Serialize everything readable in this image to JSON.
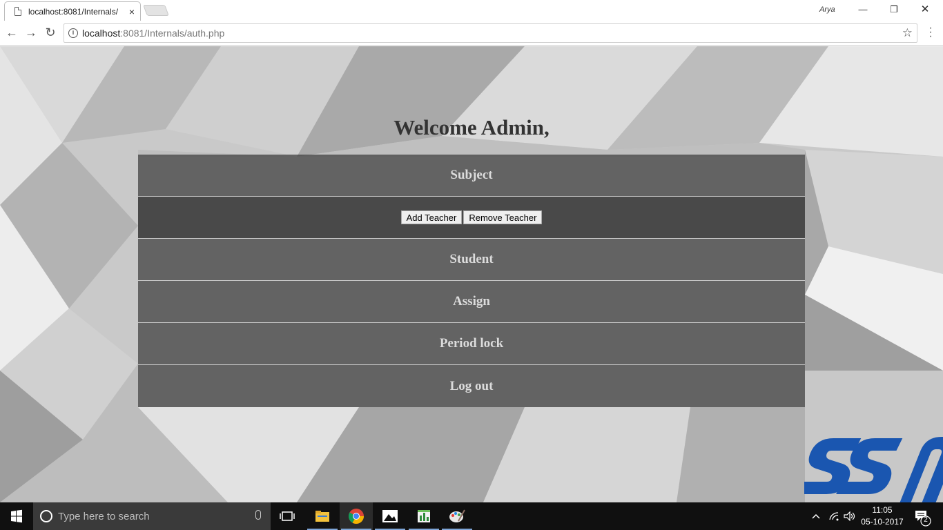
{
  "browser": {
    "tab_title": "localhost:8081/Internals/",
    "tab_close": "×",
    "profile_name": "Arya",
    "url_host": "localhost",
    "url_rest": ":8081/Internals/auth.php",
    "minimize": "—",
    "maximize": "❐",
    "close": "✕",
    "back": "←",
    "forward": "→",
    "reload": "↻",
    "star": "☆",
    "info": "i"
  },
  "page": {
    "welcome": "Welcome Admin,",
    "menu": [
      {
        "label": "Subject"
      },
      {
        "label": "Student"
      },
      {
        "label": "Assign"
      },
      {
        "label": "Period lock"
      },
      {
        "label": "Log out"
      }
    ],
    "submenu": {
      "add_teacher": "Add Teacher",
      "remove_teacher": "Remove Teacher"
    },
    "logo_text": "SSN",
    "logo_color": "#1a56b0"
  },
  "taskbar": {
    "search_placeholder": "Type here to search",
    "time": "11:05",
    "date": "05-10-2017",
    "notification_count": "2",
    "apps": [
      "task-view-icon",
      "file-explorer-icon",
      "chrome-icon",
      "photos-icon",
      "sheets-icon",
      "paint-icon"
    ]
  }
}
